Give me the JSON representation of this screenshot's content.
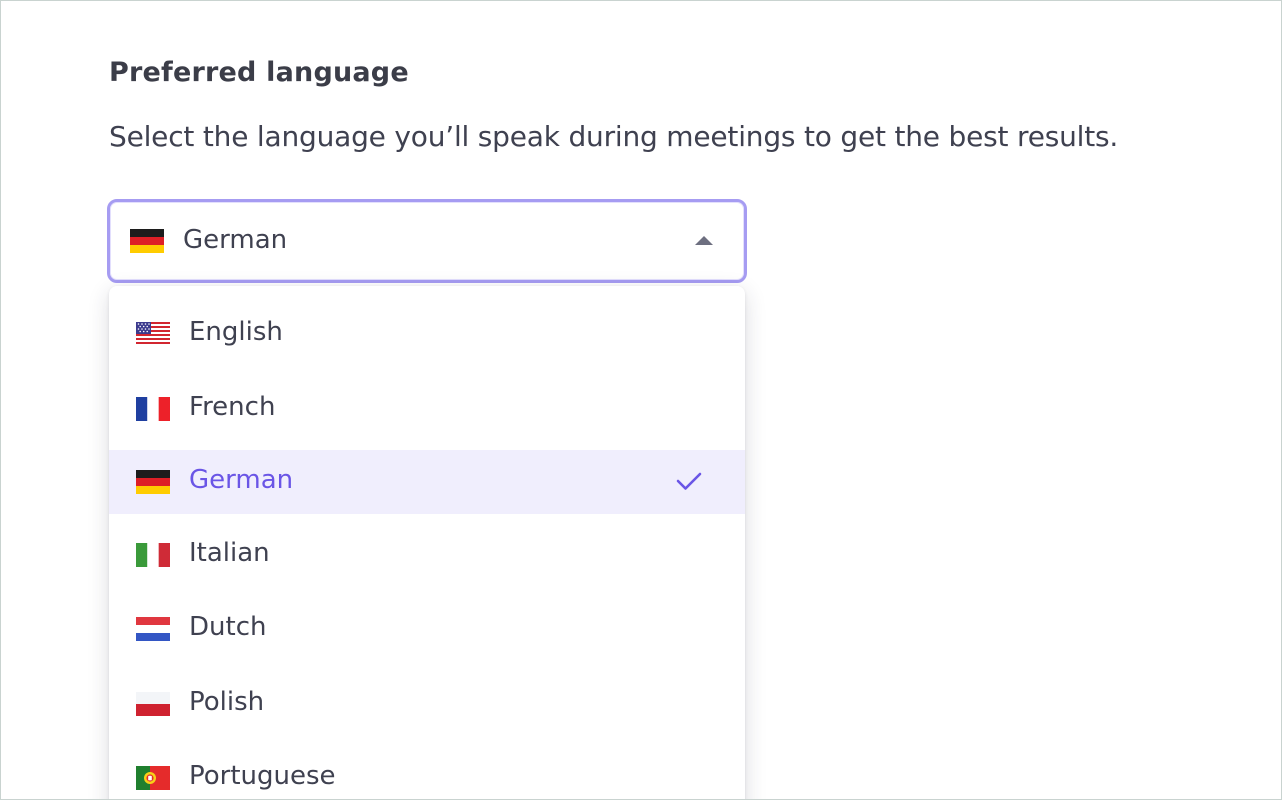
{
  "heading": "Preferred language",
  "description": "Select the language you’ll speak during meetings to get the best results.",
  "select": {
    "value": "German",
    "flag_icon": "germany-flag-icon",
    "expanded": true
  },
  "options": [
    {
      "label": "English",
      "flag_icon": "usa-flag-icon",
      "selected": false
    },
    {
      "label": "French",
      "flag_icon": "france-flag-icon",
      "selected": false
    },
    {
      "label": "German",
      "flag_icon": "germany-flag-icon",
      "selected": true
    },
    {
      "label": "Italian",
      "flag_icon": "italy-flag-icon",
      "selected": false
    },
    {
      "label": "Dutch",
      "flag_icon": "netherlands-flag-icon",
      "selected": false
    },
    {
      "label": "Polish",
      "flag_icon": "poland-flag-icon",
      "selected": false
    },
    {
      "label": "Portuguese",
      "flag_icon": "portugal-flag-icon",
      "selected": false
    }
  ],
  "colors": {
    "accent": "#6a55e6",
    "selected_background": "#f0eefd",
    "focus_border": "#a69cf2",
    "text": "#3f4150"
  }
}
